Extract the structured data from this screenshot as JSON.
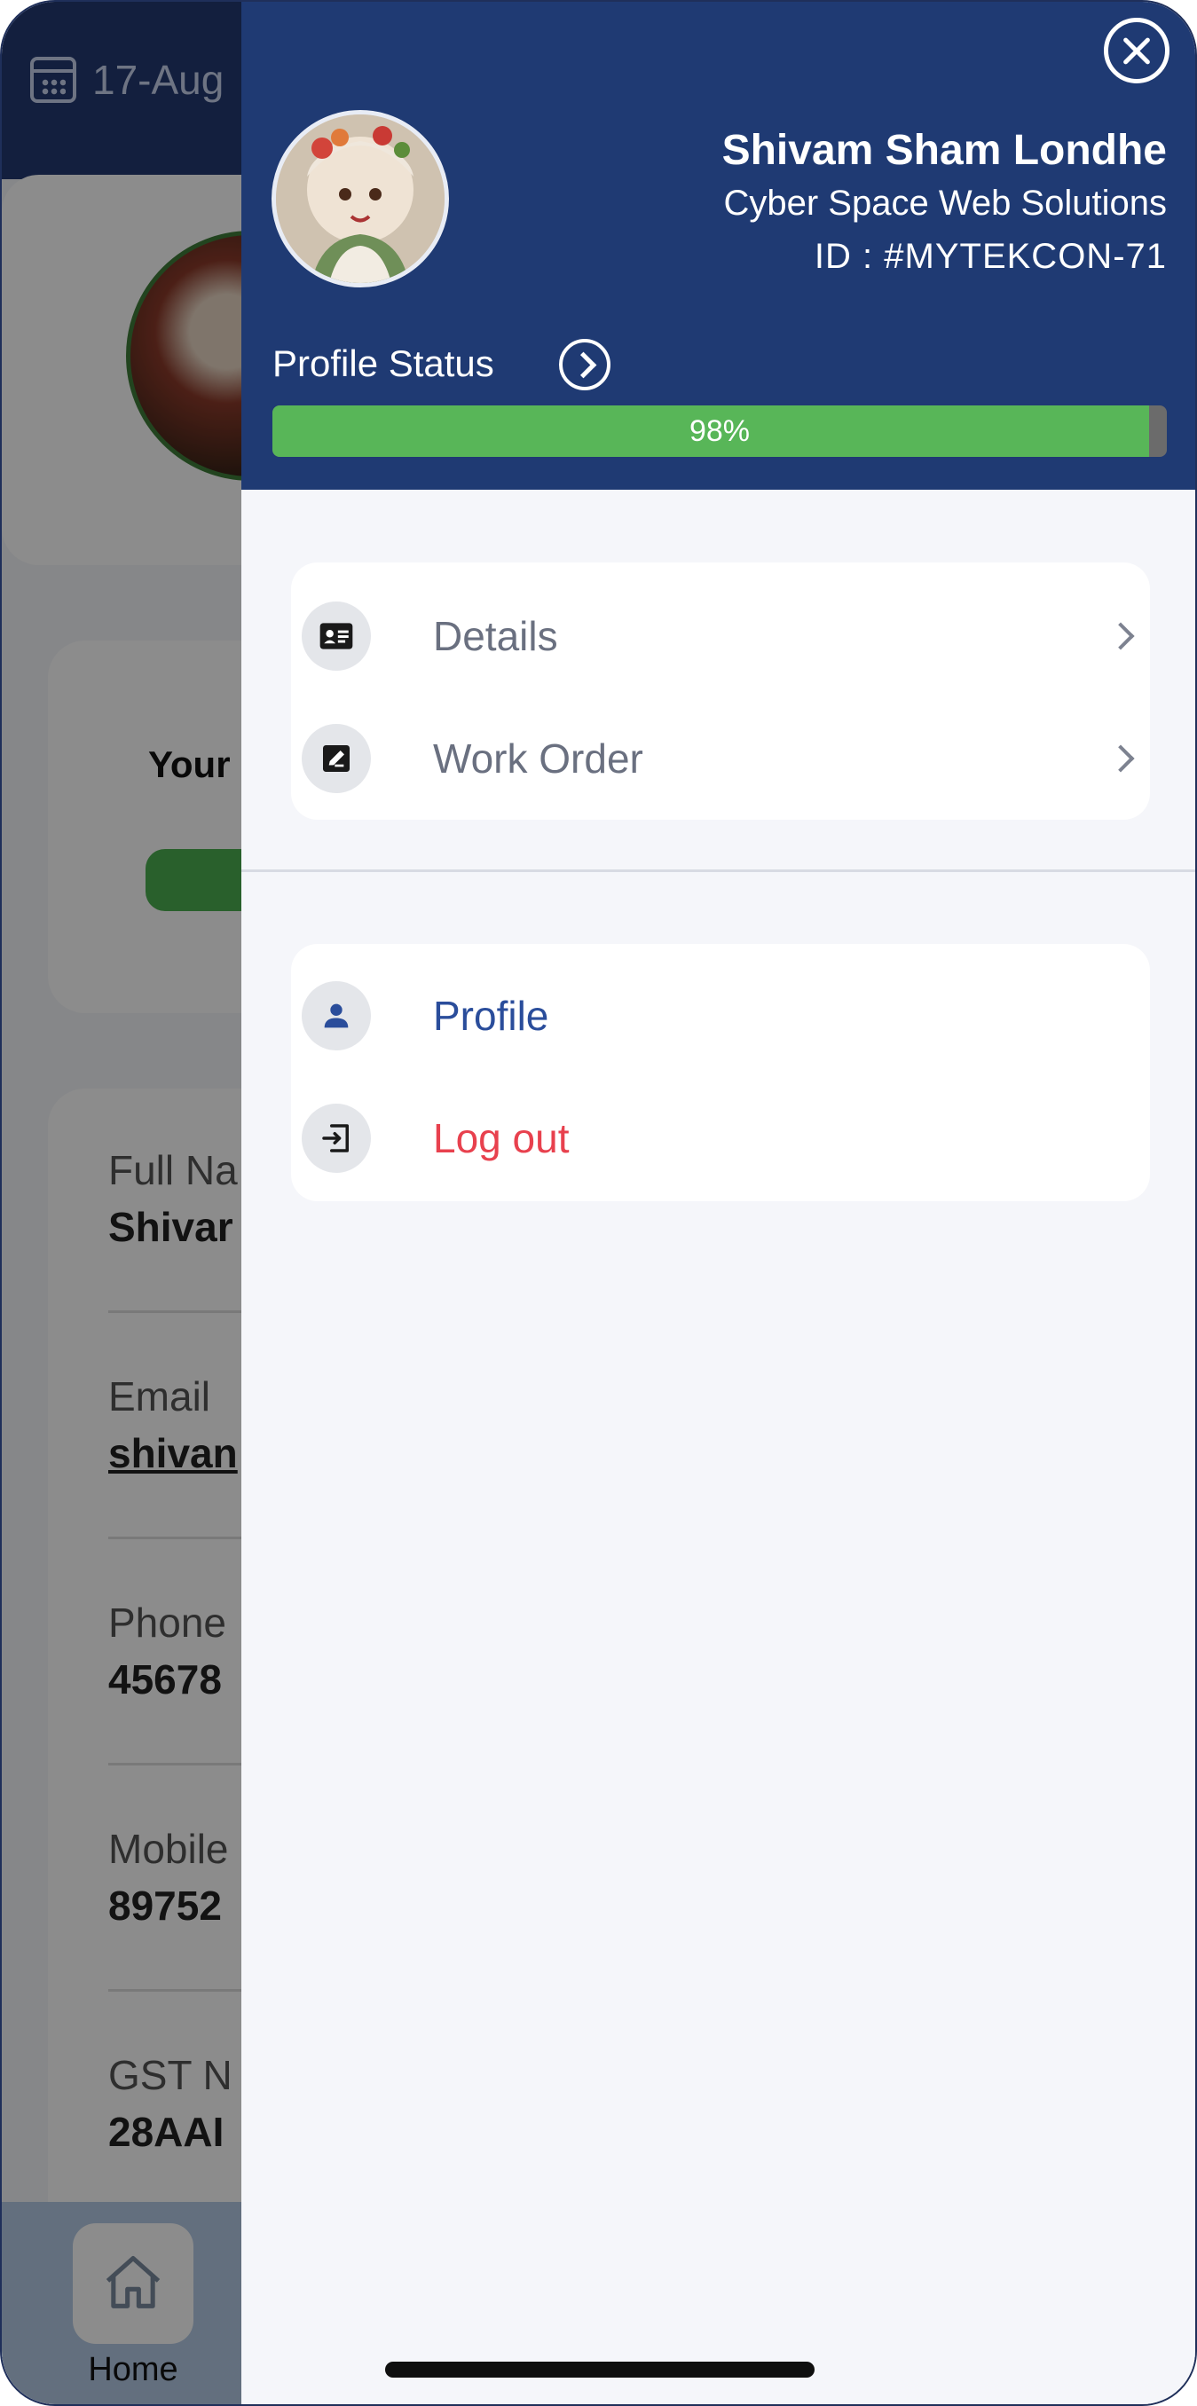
{
  "background": {
    "date_text": "17-Aug",
    "your_text": "Your",
    "rows": [
      {
        "label": "Full Na",
        "value": "Shivar"
      },
      {
        "label": "Email",
        "value": "shivan"
      },
      {
        "label": "Phone",
        "value": "45678"
      },
      {
        "label": "Mobile",
        "value": "89752"
      },
      {
        "label": "GST N",
        "value": "28AAI"
      }
    ],
    "bottom_nav": {
      "home_label": "Home",
      "home_icon": "home-icon"
    }
  },
  "drawer": {
    "close_icon": "close-icon",
    "user": {
      "name": "Shivam Sham Londhe",
      "company": "Cyber Space Web Solutions",
      "id": "ID : #MYTEKCON-71"
    },
    "profile_status": {
      "label": "Profile Status",
      "progress_percent": 98,
      "progress_text": "98%"
    },
    "menu_primary": [
      {
        "label": "Details",
        "icon": "id-card-icon"
      },
      {
        "label": "Work Order",
        "icon": "edit-icon"
      }
    ],
    "menu_secondary": [
      {
        "label": "Profile",
        "icon": "person-icon"
      },
      {
        "label": "Log out",
        "icon": "logout-icon"
      }
    ]
  },
  "colors": {
    "header_navy": "#1f3a73",
    "progress_green": "#58b658",
    "profile_blue": "#2a4d9b",
    "logout_red": "#e8414e"
  }
}
